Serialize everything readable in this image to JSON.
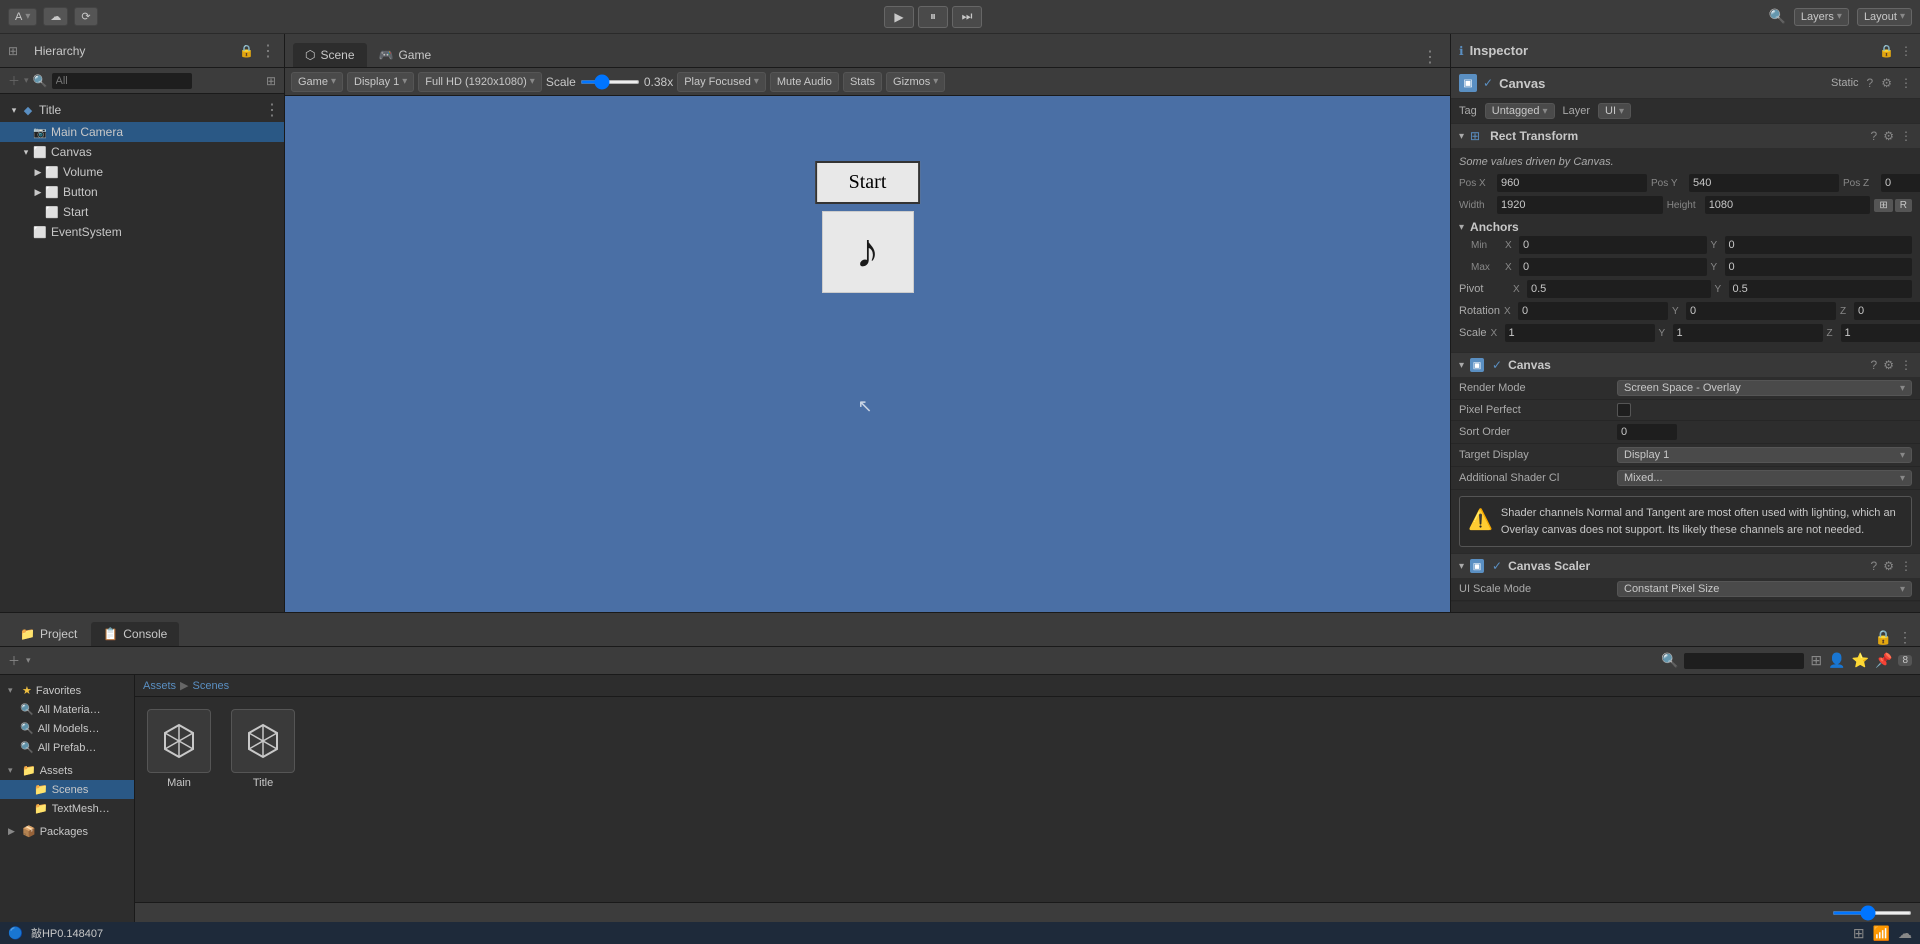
{
  "toolbar": {
    "account_label": "A",
    "cloud_icon": "☁",
    "history_icon": "⟳",
    "play_label": "▶",
    "pause_label": "⏸",
    "step_label": "⏭",
    "layers_label": "Layers",
    "layout_label": "Layout"
  },
  "hierarchy": {
    "panel_label": "Hierarchy",
    "lock_icon": "🔒",
    "more_icon": "⋮",
    "search_placeholder": "All",
    "items": [
      {
        "label": "Title",
        "icon": "◆",
        "indent": 0,
        "expanded": true,
        "has_more": true
      },
      {
        "label": "Main Camera",
        "icon": "📷",
        "indent": 1,
        "expanded": false
      },
      {
        "label": "Canvas",
        "icon": "⬜",
        "indent": 1,
        "expanded": true
      },
      {
        "label": "Volume",
        "icon": "⬜",
        "indent": 2,
        "expanded": false
      },
      {
        "label": "Button",
        "icon": "⬜",
        "indent": 2,
        "expanded": false
      },
      {
        "label": "Start",
        "icon": "⬜",
        "indent": 2,
        "expanded": false
      },
      {
        "label": "EventSystem",
        "icon": "⬜",
        "indent": 1,
        "expanded": false
      }
    ]
  },
  "game_view": {
    "scene_tab": "Scene",
    "game_tab": "Game",
    "display_label": "Display 1",
    "resolution_label": "Full HD (1920x1080)",
    "scale_label": "Scale",
    "scale_value": "0.38x",
    "play_focused_label": "Play Focused",
    "mute_audio_label": "Mute Audio",
    "stats_label": "Stats",
    "gizmos_label": "Gizmos",
    "start_btn_label": "Start",
    "game_label": "Game"
  },
  "inspector": {
    "title": "Inspector",
    "component_name": "Canvas",
    "static_label": "Static",
    "tag_label": "Tag",
    "tag_value": "Untagged",
    "layer_label": "Layer",
    "layer_value": "UI",
    "rect_transform_title": "Rect Transform",
    "driven_msg": "Some values driven by Canvas.",
    "pos_x_label": "Pos X",
    "pos_y_label": "Pos Y",
    "pos_z_label": "Pos Z",
    "pos_x_val": "960",
    "pos_y_val": "540",
    "pos_z_val": "0",
    "width_label": "Width",
    "height_label": "Height",
    "width_val": "1920",
    "height_val": "1080",
    "anchors_title": "Anchors",
    "min_label": "Min",
    "max_label": "Max",
    "pivot_label": "Pivot",
    "anchor_min_x": "0",
    "anchor_min_y": "0",
    "anchor_max_x": "0",
    "anchor_max_y": "0",
    "pivot_x": "0.5",
    "pivot_y": "0.5",
    "rotation_title": "Rotation",
    "rot_x": "0",
    "rot_y": "0",
    "rot_z": "0",
    "scale_title": "Scale",
    "scale_x": "1",
    "scale_y": "1",
    "scale_z": "1",
    "canvas_component_title": "Canvas",
    "render_mode_label": "Render Mode",
    "render_mode_value": "Screen Space - Overlay",
    "pixel_perfect_label": "Pixel Perfect",
    "sort_order_label": "Sort Order",
    "sort_order_value": "0",
    "target_display_label": "Target Display",
    "target_display_value": "Display 1",
    "additional_shader_label": "Additional Shader Cl",
    "additional_shader_value": "Mixed...",
    "warning_msg": "Shader channels Normal and Tangent are most often used with lighting, which an Overlay canvas does not support. Its likely these channels are not needed.",
    "canvas_scaler_title": "Canvas Scaler",
    "ui_scale_mode_label": "UI Scale Mode",
    "ui_scale_mode_value": "Constant Pixel Size"
  },
  "project": {
    "project_tab": "Project",
    "console_tab": "Console",
    "breadcrumb_assets": "Assets",
    "breadcrumb_scenes": "Scenes",
    "sidebar_favorites_label": "Favorites",
    "sidebar_all_materials": "All Materia…",
    "sidebar_all_models": "All Models…",
    "sidebar_all_prefabs": "All Prefab…",
    "sidebar_assets_label": "Assets",
    "sidebar_scenes": "Scenes",
    "sidebar_textmesh": "TextMesh…",
    "sidebar_packages": "Packages",
    "files": [
      {
        "name": "Main",
        "icon": "unity"
      },
      {
        "name": "Title",
        "icon": "unity"
      }
    ]
  },
  "status_bar": {
    "status_icon": "🔵",
    "status_text": "敲HP0.148407"
  }
}
